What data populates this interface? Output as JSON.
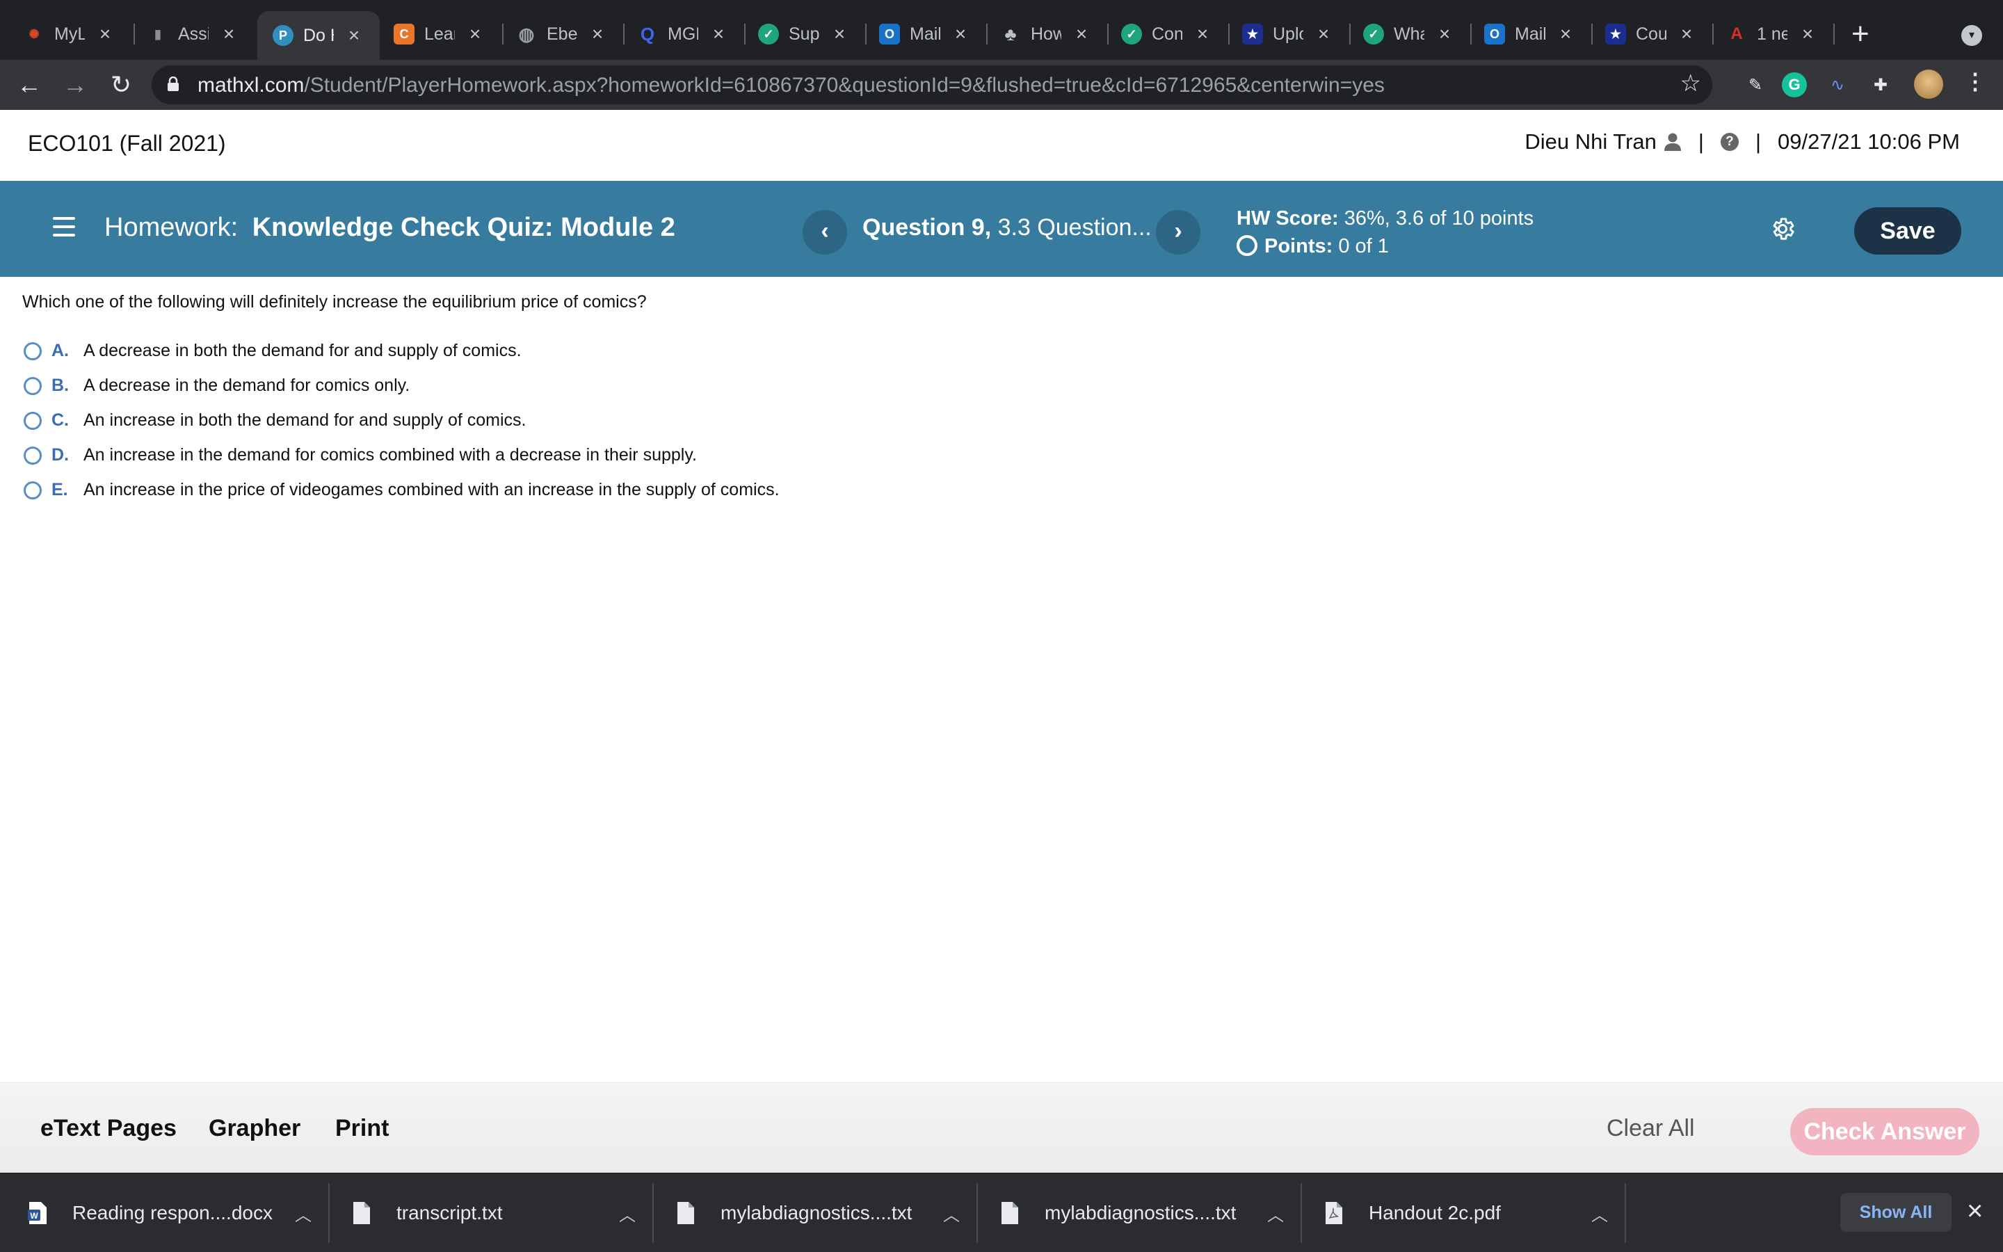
{
  "browser": {
    "tabs": [
      {
        "label": "MyL",
        "icon": "pearson-icon",
        "color": "#d7452a",
        "glyph": "✺",
        "active": false
      },
      {
        "label": "Assi",
        "icon": "book-icon",
        "color": "#8a8d91",
        "glyph": "▮",
        "active": false
      },
      {
        "label": "Do H",
        "icon": "pearson-p-icon",
        "color": "#2f8fbf",
        "glyph": "P",
        "active": true
      },
      {
        "label": "Lear",
        "icon": "c-icon",
        "color": "#e8752a",
        "glyph": "C",
        "active": false
      },
      {
        "label": "Ebe",
        "icon": "globe-icon",
        "color": "#9aa0a6",
        "glyph": "◍",
        "active": false
      },
      {
        "label": "MGM",
        "icon": "search-q-icon",
        "color": "#3c63f1",
        "glyph": "Q",
        "active": false
      },
      {
        "label": "Sup",
        "icon": "shield-check-icon",
        "color": "#1fa57e",
        "glyph": "✓",
        "active": false
      },
      {
        "label": "Mail",
        "icon": "outlook-icon",
        "color": "#1a73c8",
        "glyph": "O",
        "active": false
      },
      {
        "label": "How",
        "icon": "tree-icon",
        "color": "#bdc1c6",
        "glyph": "♣",
        "active": false
      },
      {
        "label": "Con",
        "icon": "shield-check-icon",
        "color": "#1fa57e",
        "glyph": "✓",
        "active": false
      },
      {
        "label": "Uplo",
        "icon": "star-icon",
        "color": "#1b2d8f",
        "glyph": "★",
        "active": false
      },
      {
        "label": "Wha",
        "icon": "shield-check-icon",
        "color": "#1fa57e",
        "glyph": "✓",
        "active": false
      },
      {
        "label": "Mail",
        "icon": "outlook-icon",
        "color": "#1a73c8",
        "glyph": "O",
        "active": false
      },
      {
        "label": "Cou",
        "icon": "star-icon",
        "color": "#1b2d8f",
        "glyph": "★",
        "active": false
      },
      {
        "label": "1 ne",
        "icon": "a-plus-icon",
        "color": "#d93025",
        "glyph": "A",
        "active": false
      }
    ],
    "new_tab_label": "+",
    "url_domain": "mathxl.com",
    "url_path": "/Student/PlayerHomework.aspx?homeworkId=610867370&questionId=9&flushed=true&cId=6712965&centerwin=yes"
  },
  "header": {
    "course": "ECO101 (Fall 2021)",
    "user": "Dieu Nhi Tran",
    "pipe": "|",
    "datetime": "09/27/21 10:06 PM"
  },
  "hw": {
    "prefix": "Homework:",
    "title": "Knowledge Check Quiz: Module 2",
    "question_label": "Question 9,",
    "question_section": "3.3 Question...",
    "score_label": "HW Score:",
    "score_value": "36%, 3.6 of 10 points",
    "points_label": "Points:",
    "points_value": "0 of 1",
    "save_label": "Save",
    "prev_glyph": "‹",
    "next_glyph": "›"
  },
  "question": {
    "prompt": "Which one of the following will definitely increase the equilibrium price of comics?",
    "choices": [
      {
        "letter": "A.",
        "text": "A decrease in both the demand for and supply of comics."
      },
      {
        "letter": "B.",
        "text": "A decrease in the demand for comics only."
      },
      {
        "letter": "C.",
        "text": "An increase in both the demand for and supply of comics."
      },
      {
        "letter": "D.",
        "text": "An increase in the demand for comics combined with a decrease in their supply."
      },
      {
        "letter": "E.",
        "text": "An increase in the price of videogames combined with an increase in the supply of comics."
      }
    ]
  },
  "bottom": {
    "etext": "eText Pages",
    "grapher": "Grapher",
    "print": "Print",
    "clear_all": "Clear All",
    "check_answer": "Check Answer"
  },
  "downloads": {
    "items": [
      {
        "name": "Reading respon....docx",
        "icon": "word-doc-icon"
      },
      {
        "name": "transcript.txt",
        "icon": "file-icon"
      },
      {
        "name": "mylabdiagnostics....txt",
        "icon": "file-icon"
      },
      {
        "name": "mylabdiagnostics....txt",
        "icon": "file-icon"
      },
      {
        "name": "Handout 2c.pdf",
        "icon": "pdf-file-icon"
      }
    ],
    "show_all": "Show All"
  },
  "colors": {
    "band": "#377b9e",
    "save_button": "#1c3347",
    "check_answer_disabled": "#f3b4c1",
    "choice_letter": "#3b6db5"
  }
}
